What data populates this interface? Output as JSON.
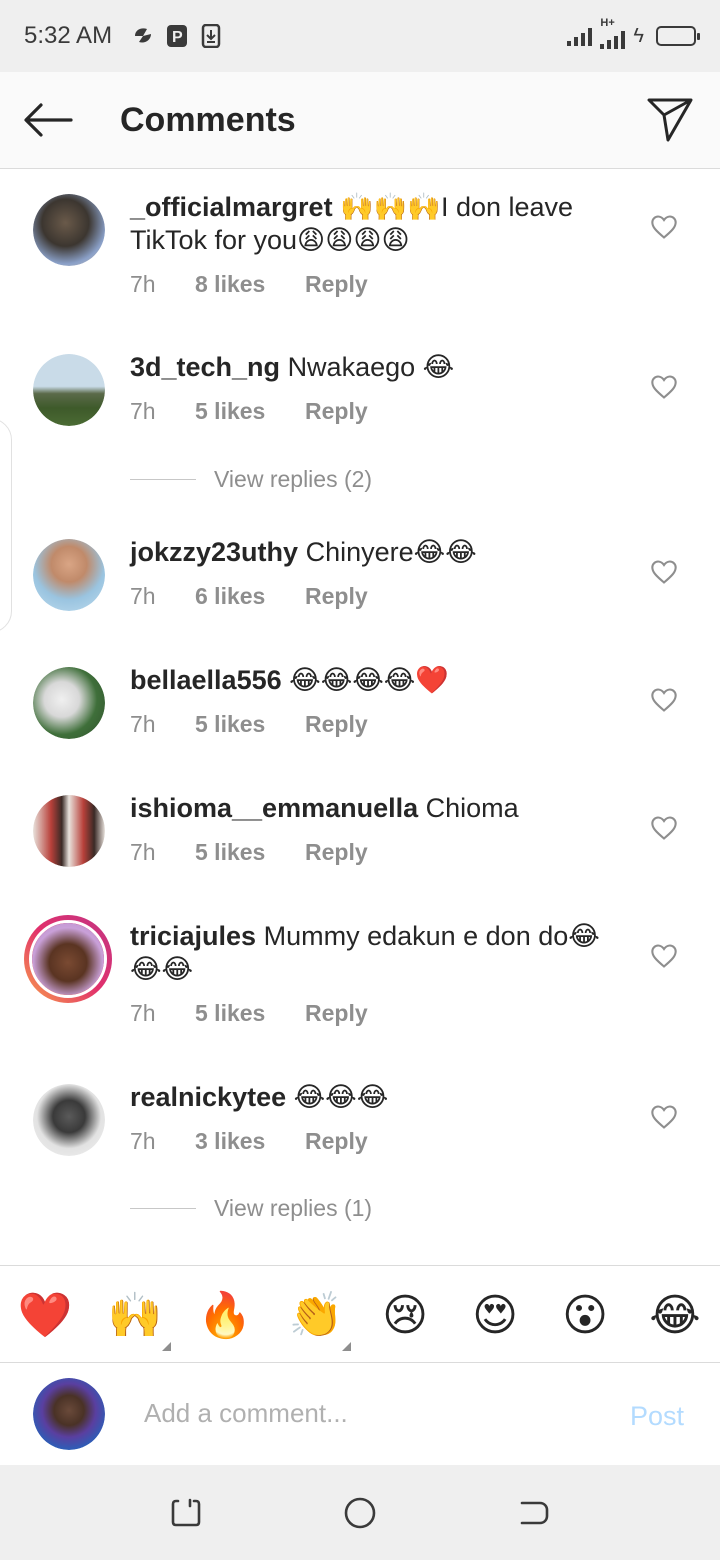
{
  "status_bar": {
    "time": "5:32 AM",
    "network": "H+"
  },
  "header": {
    "title": "Comments"
  },
  "comments": [
    {
      "user": "_officialmargret",
      "text": "🙌🙌🙌I don leave TikTok for you😩😩😩😩",
      "time": "7h",
      "likes": "8 likes",
      "reply": "Reply"
    },
    {
      "user": "3d_tech_ng",
      "text": "Nwakaego 😂",
      "time": "7h",
      "likes": "5 likes",
      "reply": "Reply",
      "view_replies": "View replies (2)"
    },
    {
      "user": "jokzzy23uthy",
      "text": "Chinyere😂😂",
      "time": "7h",
      "likes": "6 likes",
      "reply": "Reply"
    },
    {
      "user": "bellaella556",
      "text": "😂😂😂😂❤️",
      "time": "7h",
      "likes": "5 likes",
      "reply": "Reply"
    },
    {
      "user": "ishioma__emmanuella",
      "text": "Chioma",
      "time": "7h",
      "likes": "5 likes",
      "reply": "Reply"
    },
    {
      "user": "triciajules",
      "text": "Mummy edakun e don do😂😂😂",
      "time": "7h",
      "likes": "5 likes",
      "reply": "Reply"
    },
    {
      "user": "realnickytee",
      "text": "😂😂😂",
      "time": "7h",
      "likes": "3 likes",
      "reply": "Reply",
      "view_replies": "View replies (1)"
    }
  ],
  "emoji_bar": [
    "❤️",
    "🙌",
    "🔥",
    "👏",
    "😢",
    "😍",
    "😮",
    "😂"
  ],
  "comment_input": {
    "placeholder": "Add a comment...",
    "post_label": "Post"
  },
  "colors": {
    "post_disabled": "#b3dbff",
    "secondary_text": "#8e8e8e",
    "story_ring": "#e1306c"
  }
}
